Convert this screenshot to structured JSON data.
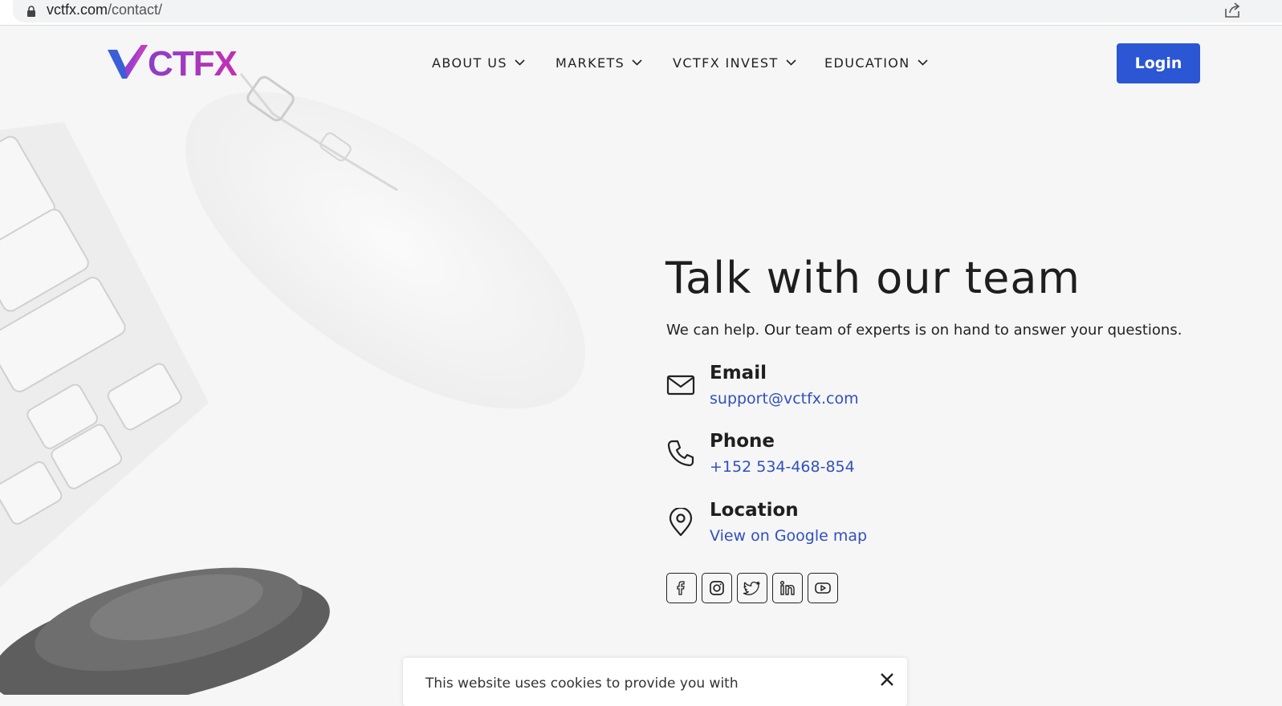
{
  "browser": {
    "url_domain": "vctfx.com",
    "url_path": "/contact/"
  },
  "header": {
    "logo_text": "CTFX",
    "nav": [
      {
        "label": "ABOUT US"
      },
      {
        "label": "MARKETS"
      },
      {
        "label": "VCTFX INVEST"
      },
      {
        "label": "EDUCATION"
      }
    ],
    "login_label": "Login"
  },
  "contact": {
    "title": "Talk with our team",
    "subtitle": "We can help. Our team of experts is on hand to answer your questions.",
    "items": [
      {
        "label": "Email",
        "value": "support@vctfx.com",
        "icon": "mail-icon"
      },
      {
        "label": "Phone",
        "value": "+152 534-468-854",
        "icon": "phone-icon"
      },
      {
        "label": "Location",
        "value": "View on Google map",
        "icon": "location-pin-icon"
      }
    ],
    "socials": [
      "facebook-icon",
      "instagram-icon",
      "twitter-icon",
      "linkedin-icon",
      "youtube-icon"
    ]
  },
  "cookie_banner": {
    "text": "This website uses cookies to provide you with"
  },
  "colors": {
    "accent": "#2b56d4",
    "link": "#3050bf",
    "logo_gradient_start": "#8a3fc7",
    "logo_gradient_end": "#c42fb4"
  }
}
